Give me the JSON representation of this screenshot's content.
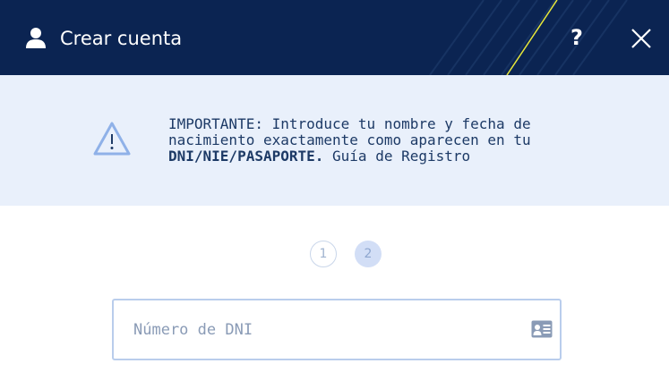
{
  "header": {
    "title": "Crear cuenta",
    "help_label": "?",
    "icons": {
      "user": "user-icon",
      "close": "close-icon"
    },
    "background_color": "#0b2452"
  },
  "notice": {
    "icon": "warning-triangle-icon",
    "line1": "IMPORTANTE: Introduce tu nombre y fecha de",
    "line2": "nacimiento exactamente como aparecen en tu",
    "line3_bold": "DNI/NIE/PASAPORTE.",
    "link_text": "Guía de Registro",
    "background_color": "#e9f0fb"
  },
  "steps": [
    {
      "label": "1",
      "state": "inactive"
    },
    {
      "label": "2",
      "state": "current"
    }
  ],
  "form": {
    "document_number": {
      "placeholder": "Número de DNI",
      "value": "",
      "icon": "id-card-icon"
    }
  }
}
